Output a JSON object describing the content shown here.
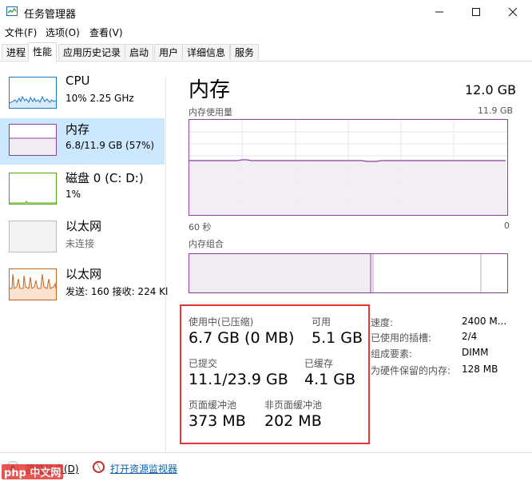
{
  "window": {
    "title": "任务管理器",
    "controls": {
      "minimize": "—",
      "maximize": "☐",
      "close": "✕"
    }
  },
  "menu": [
    "文件(F)",
    "选项(O)",
    "查看(V)"
  ],
  "tabs": [
    {
      "label": "进程",
      "active": false
    },
    {
      "label": "性能",
      "active": true
    },
    {
      "label": "应用历史记录",
      "active": false
    },
    {
      "label": "启动",
      "active": false
    },
    {
      "label": "用户",
      "active": false
    },
    {
      "label": "详细信息",
      "active": false
    },
    {
      "label": "服务",
      "active": false
    }
  ],
  "sidebar": [
    {
      "name": "CPU",
      "sub": "10% 2.25 GHz",
      "selected": false,
      "color": "#1979c9",
      "icon": "cpu-graph"
    },
    {
      "name": "内存",
      "sub": "6.8/11.9 GB (57%)",
      "selected": true,
      "color": "#8b3f9e",
      "icon": "memory-graph"
    },
    {
      "name": "磁盘 0 (C: D:)",
      "sub": "1%",
      "selected": false,
      "color": "#4da60c",
      "icon": "disk-graph"
    },
    {
      "name": "以太网",
      "sub": "未连接",
      "selected": false,
      "color": "#bdbdbd",
      "icon": "ethernet-graph",
      "sub_grey": true
    },
    {
      "name": "以太网",
      "sub": "发送: 160 接收: 224 Kl",
      "selected": false,
      "color": "#c8631c",
      "icon": "ethernet-graph"
    }
  ],
  "memory": {
    "title": "内存",
    "total": "12.0 GB",
    "usage_label": "内存使用量",
    "usage_max": "11.9 GB",
    "time_left": "60 秒",
    "time_right": "0",
    "usage_fraction": 0.57,
    "composition_label": "内存组合",
    "stats": {
      "in_use_label": "使用中(已压缩)",
      "in_use_value": "6.7 GB (0 MB)",
      "available_label": "可用",
      "available_value": "5.1 GB",
      "committed_label": "已提交",
      "committed_value": "11.1/23.9 GB",
      "cached_label": "已缓存",
      "cached_value": "4.1 GB",
      "paged_label": "页面缓冲池",
      "paged_value": "373 MB",
      "nonpaged_label": "非页面缓冲池",
      "nonpaged_value": "202 MB"
    },
    "props": {
      "speed_label": "速度:",
      "speed_value": "2400 M...",
      "slots_label": "已使用的插槽:",
      "slots_value": "2/4",
      "form_label": "组成要素:",
      "form_value": "DIMM",
      "reserved_label": "为硬件保留的内存:",
      "reserved_value": "128 MB"
    }
  },
  "footer": {
    "fewer_details": "简略信息(D)",
    "open_monitor": "打开资源监视器",
    "watermark": "php 中文网"
  },
  "colors": {
    "memory": "#8b3f9e",
    "memory_fill": "#f1ecf3",
    "highlight": "#e53935",
    "selected_bg": "#cce8ff"
  }
}
